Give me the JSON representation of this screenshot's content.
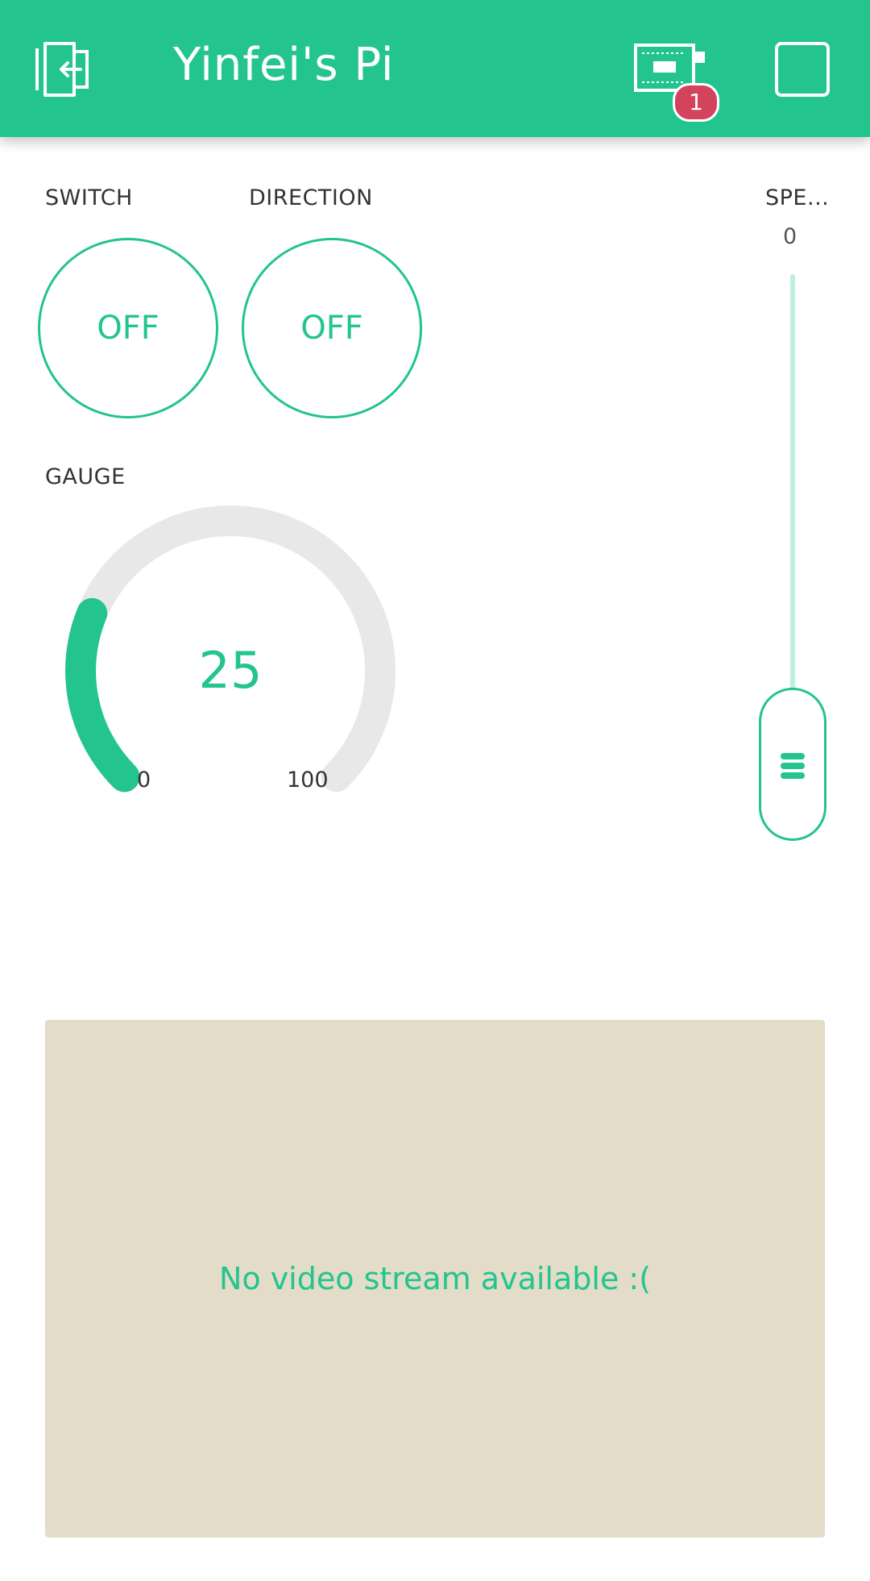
{
  "app_bar": {
    "title": "Yinfei's Pi",
    "badge_count": "1",
    "icons": {
      "back": "exit-to-left-icon",
      "device": "device-board-icon",
      "stop": "square-stop-icon"
    },
    "colors": {
      "background": "#23c48e",
      "text": "#ffffff",
      "badge": "#d3435c"
    }
  },
  "widgets": {
    "switch": {
      "label": "SWITCH",
      "state": "OFF"
    },
    "direction": {
      "label": "DIRECTION",
      "state": "OFF"
    },
    "gauge": {
      "label": "GAUGE",
      "value": "25",
      "min": "0",
      "max": "100",
      "fraction": 0.25
    },
    "speed": {
      "label": "SPE...",
      "value": "0"
    }
  },
  "video": {
    "message": "No video stream available :("
  },
  "colors": {
    "accent": "#23c48e",
    "video_bg": "#e2dcc9",
    "track": "#bdf0da"
  }
}
